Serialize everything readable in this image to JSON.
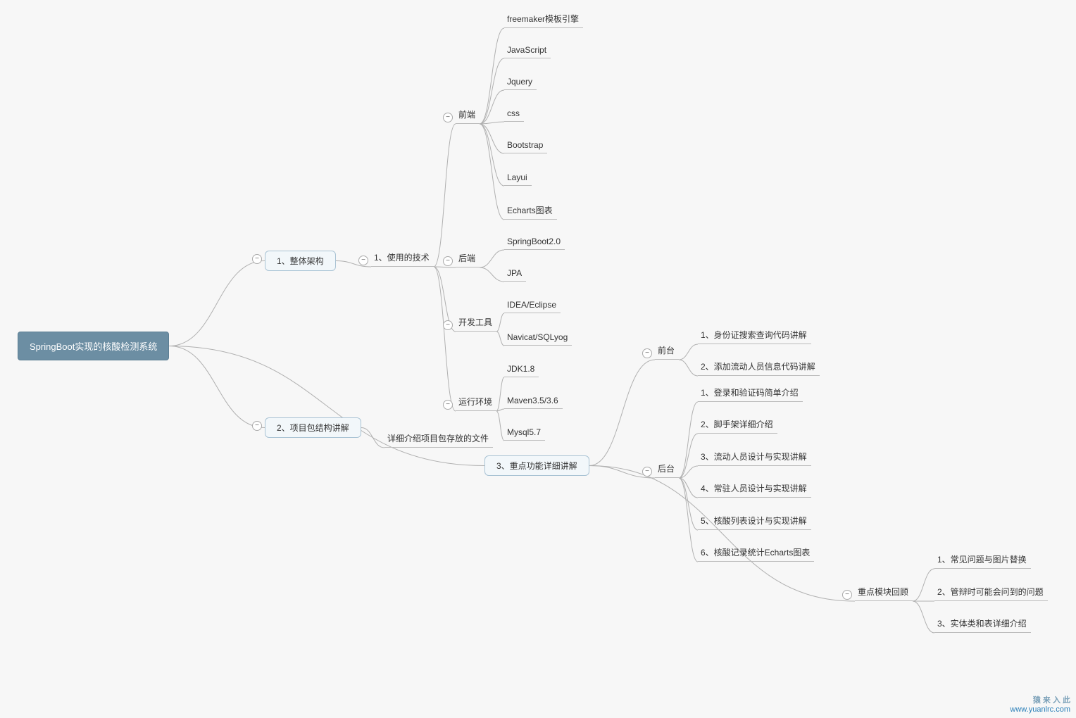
{
  "root": {
    "label": "SpringBoot实现的核酸检测系统"
  },
  "level1": {
    "architecture": "1、整体架构",
    "packageStructure": "2、项目包结构讲解",
    "packageStructure_note": "详细介绍项目包存放的文件",
    "keyFunctions": "3、重点功能详细讲解"
  },
  "tech": {
    "label": "1、使用的技术",
    "frontend": {
      "label": "前端",
      "items": [
        "freemaker模板引擎",
        "JavaScript",
        "Jquery",
        "css",
        "Bootstrap",
        "Layui",
        "Echarts图表"
      ]
    },
    "backend": {
      "label": "后端",
      "items": [
        "SpringBoot2.0",
        "JPA"
      ]
    },
    "tools": {
      "label": "开发工具",
      "items": [
        "IDEA/Eclipse",
        "Navicat/SQLyog"
      ]
    },
    "env": {
      "label": "运行环境",
      "items": [
        "JDK1.8",
        "Maven3.5/3.6",
        "Mysql5.7"
      ]
    }
  },
  "keyFunc": {
    "front": {
      "label": "前台",
      "items": [
        "1、身份证搜索查询代码讲解",
        "2、添加流动人员信息代码讲解"
      ]
    },
    "back": {
      "label": "后台",
      "items": [
        "1、登录和验证码简单介绍",
        "2、脚手架详细介绍",
        "3、流动人员设计与实现讲解",
        "4、常驻人员设计与实现讲解",
        "5、核酸列表设计与实现讲解",
        "6、核酸记录统计Echarts图表"
      ]
    },
    "review": {
      "label": "重点模块回顾",
      "items": [
        "1、常见问题与图片替换",
        "2、管辩时可能会问到的问题",
        "3、实体类和表详细介绍"
      ]
    }
  },
  "watermark": {
    "line1": "猿 来 入 此",
    "line2": "www.yuanlrc.com"
  }
}
